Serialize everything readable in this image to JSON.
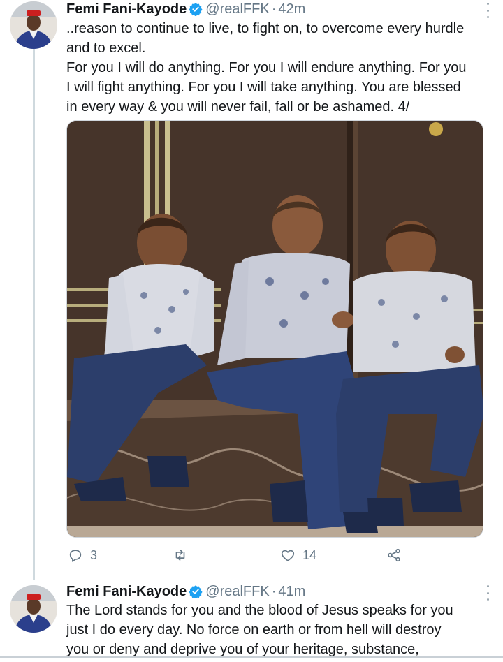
{
  "tweets": [
    {
      "author": {
        "name": "Femi Fani-Kayode",
        "handle": "@realFFK",
        "separator": "·",
        "time": "42m",
        "verified": true
      },
      "text_lines": [
        "..reason to continue to live, to fight on, to overcome every hurdle",
        "and to excel.",
        "For you I will do anything. For you I will endure anything. For you",
        "I will fight anything. For you I will take anything. You are blessed",
        "in every way & you will never fail, fall or be ashamed. 4/"
      ],
      "actions": {
        "reply_count": "3",
        "retweet_count": "",
        "like_count": "14"
      }
    },
    {
      "author": {
        "name": "Femi Fani-Kayode",
        "handle": "@realFFK",
        "separator": "·",
        "time": "41m",
        "verified": true
      },
      "text_lines": [
        "The Lord stands for you and the blood of Jesus speaks for you",
        "just I do every day. No force on earth or from hell will destroy",
        "you or deny and deprive you of your heritage, substance,"
      ]
    }
  ],
  "colors": {
    "text_primary": "#14171a",
    "text_secondary": "#657786",
    "verified_blue": "#1da1f2",
    "thread_line": "#cfd9de"
  },
  "icons": {
    "verified": "verified-badge-icon",
    "more": "more-vertical-icon",
    "reply": "reply-icon",
    "retweet": "retweet-icon",
    "like": "heart-icon",
    "share": "share-icon"
  }
}
